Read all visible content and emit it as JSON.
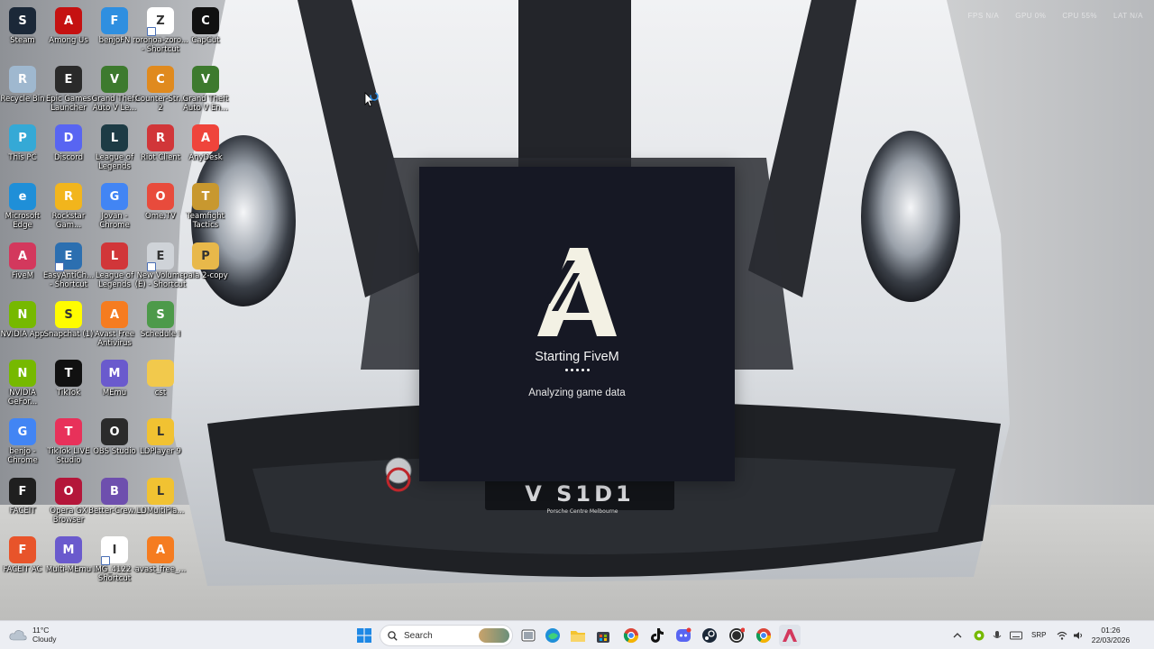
{
  "desktop": {
    "icons": [
      {
        "label": "Steam",
        "color": "#1b2838",
        "glyph": "S"
      },
      {
        "label": "Among Us",
        "color": "#c51111",
        "glyph": "A"
      },
      {
        "label": "benjoFN",
        "color": "#2f8fe0",
        "glyph": "F"
      },
      {
        "label": "roronoa-zoro... - Shortcut",
        "color": "#ffffff",
        "glyph": "Z"
      },
      {
        "label": "CapCut",
        "color": "#111111",
        "glyph": "C"
      },
      {
        "label": "Recycle Bin",
        "color": "#9fb8cf",
        "glyph": "R"
      },
      {
        "label": "Epic Games Launcher",
        "color": "#2a2a2a",
        "glyph": "E"
      },
      {
        "label": "Grand Theft Auto V Le...",
        "color": "#3d7a2e",
        "glyph": "V"
      },
      {
        "label": "Counter-Str... 2",
        "color": "#e08a1e",
        "glyph": "C"
      },
      {
        "label": "Grand Theft Auto V En...",
        "color": "#3d7a2e",
        "glyph": "V"
      },
      {
        "label": "This PC",
        "color": "#35a9d6",
        "glyph": "P"
      },
      {
        "label": "Discord",
        "color": "#5865f2",
        "glyph": "D"
      },
      {
        "label": "League of Legends",
        "color": "#1d3b45",
        "glyph": "L"
      },
      {
        "label": "Riot Client",
        "color": "#d13639",
        "glyph": "R"
      },
      {
        "label": "AnyDesk",
        "color": "#ef443b",
        "glyph": "A"
      },
      {
        "label": "Microsoft Edge",
        "color": "#1f8fd8",
        "glyph": "e"
      },
      {
        "label": "Rockstar Gam...",
        "color": "#f2b51c",
        "glyph": "R"
      },
      {
        "label": "Jovan - Chrome",
        "color": "#4285f4",
        "glyph": "G"
      },
      {
        "label": "Ome.TV",
        "color": "#e84b3c",
        "glyph": "O"
      },
      {
        "label": "Teamfight Tactics",
        "color": "#c8982f",
        "glyph": "T"
      },
      {
        "label": "FiveM",
        "color": "#d3385d",
        "glyph": "A"
      },
      {
        "label": "EasyAntiCh... - Shortcut",
        "color": "#2c6fb0",
        "glyph": "E"
      },
      {
        "label": "League of Legends",
        "color": "#d13639",
        "glyph": "L"
      },
      {
        "label": "New Volume (E) - Shortcut",
        "color": "#cfd3d8",
        "glyph": "E"
      },
      {
        "label": "pala 2-copy",
        "color": "#e8b84a",
        "glyph": "P"
      },
      {
        "label": "NVIDIA App",
        "color": "#76b900",
        "glyph": "N"
      },
      {
        "label": "Snapchat (1)",
        "color": "#fffc00",
        "glyph": "S"
      },
      {
        "label": "Avast Free Antivirus",
        "color": "#f57c20",
        "glyph": "A"
      },
      {
        "label": "Schedule I",
        "color": "#4d9a4a",
        "glyph": "S"
      },
      {
        "label": "NVIDIA GeFor...",
        "color": "#76b900",
        "glyph": "N"
      },
      {
        "label": "TikTok",
        "color": "#111111",
        "glyph": "T"
      },
      {
        "label": "MEmu",
        "color": "#6a5acd",
        "glyph": "M"
      },
      {
        "label": "cst",
        "color": "#f2c94c",
        "glyph": ""
      },
      {
        "label": "benjo - Chrome",
        "color": "#4285f4",
        "glyph": "G"
      },
      {
        "label": "TikTok LIVE Studio",
        "color": "#e8315a",
        "glyph": "T"
      },
      {
        "label": "OBS Studio",
        "color": "#2b2b2b",
        "glyph": "O"
      },
      {
        "label": "LDPlayer 9",
        "color": "#f1c232",
        "glyph": "L"
      },
      {
        "label": "FACEIT",
        "color": "#1f1f1f",
        "glyph": "F"
      },
      {
        "label": "Opera GX Browser",
        "color": "#b4163a",
        "glyph": "O"
      },
      {
        "label": "Better-Crew...",
        "color": "#6e4fae",
        "glyph": "B"
      },
      {
        "label": "LDMultiPla...",
        "color": "#f1c232",
        "glyph": "L"
      },
      {
        "label": "FACEIT AC",
        "color": "#e8542a",
        "glyph": "F"
      },
      {
        "label": "Multi-MEmu",
        "color": "#6a5acd",
        "glyph": "M"
      },
      {
        "label": "IMG_4122 - Shortcut",
        "color": "#ffffff",
        "glyph": "I"
      },
      {
        "label": "avast_free_...",
        "color": "#f57c20",
        "glyph": "A"
      }
    ]
  },
  "splash": {
    "title": "Starting FiveM",
    "status": "Analyzing game data",
    "bg_color": "#161824",
    "logo_color": "#f3f1e4"
  },
  "taskbar": {
    "weather_temp": "11°C",
    "weather_desc": "Cloudy",
    "search_label": "Search",
    "language": "SRP",
    "time": "01:26",
    "date": "22/03/2026",
    "pinned": [
      "start-icon",
      "search-icon",
      "task-view-icon",
      "edge-icon",
      "file-explorer-icon",
      "store-icon",
      "chrome-icon",
      "tiktok-icon",
      "discord-icon",
      "steam-icon",
      "obs-icon",
      "chrome-icon",
      "fivem-icon"
    ],
    "tray_icons": [
      "chevron-up-icon",
      "nvidia-icon",
      "mic-icon",
      "keyboard-icon",
      "wifi-icon",
      "volume-icon"
    ]
  }
}
